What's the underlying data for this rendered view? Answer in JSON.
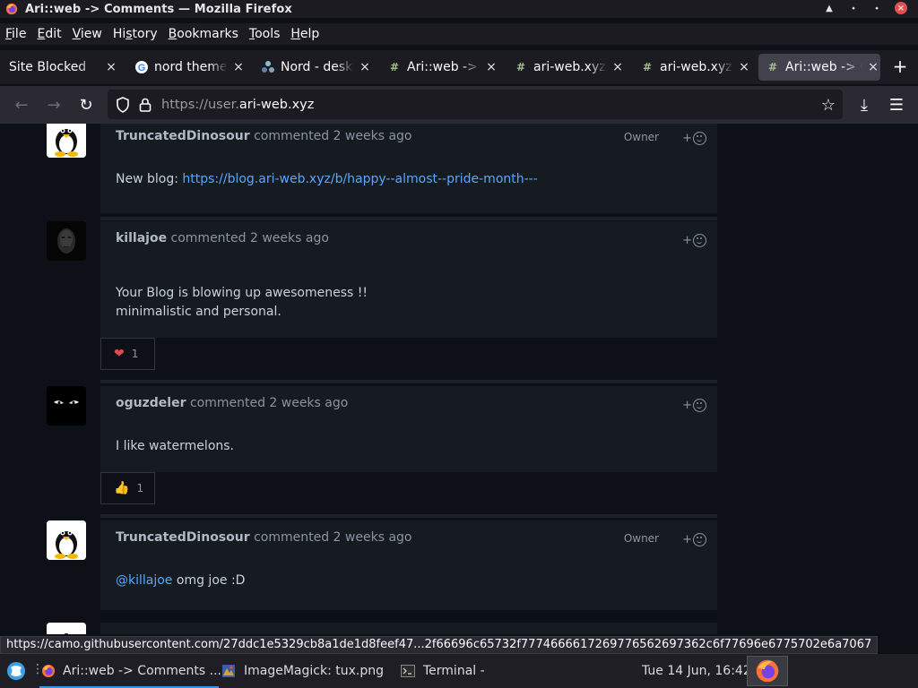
{
  "window": {
    "title": "Ari::web -> Comments — Mozilla Firefox",
    "controls": {
      "maximize": "▲",
      "minimize": "⬩",
      "restore": "⬩",
      "close": "×"
    }
  },
  "menu": {
    "items": [
      {
        "label": "File",
        "key": "F",
        "rest": "ile"
      },
      {
        "label": "Edit",
        "key": "E",
        "rest": "dit"
      },
      {
        "label": "View",
        "key": "V",
        "rest": "iew"
      },
      {
        "label": "History",
        "pre": "Hi",
        "key": "s",
        "rest": "tory"
      },
      {
        "label": "Bookmarks",
        "key": "B",
        "rest": "ookmarks"
      },
      {
        "label": "Tools",
        "key": "T",
        "rest": "ools"
      },
      {
        "label": "Help",
        "key": "H",
        "rest": "elp"
      }
    ]
  },
  "tabs": [
    {
      "label": "Site Blocked",
      "icon": "none",
      "active": false
    },
    {
      "label": "nord theme",
      "icon": "google-icon",
      "active": false
    },
    {
      "label": "Nord - deskt",
      "icon": "nord-icon",
      "active": false
    },
    {
      "label": "Ari::web -> C",
      "icon": "hash-icon",
      "active": false
    },
    {
      "label": "ari-web.xyz/",
      "icon": "hash-icon",
      "active": false
    },
    {
      "label": "ari-web.xyz/",
      "icon": "hash-icon",
      "active": false
    },
    {
      "label": "Ari::web -> C",
      "icon": "hash-icon",
      "active": true
    }
  ],
  "newtab_label": "+",
  "nav": {
    "url_prefix": "https://user.",
    "url_host": "ari-web.xyz",
    "icons": {
      "back": "←",
      "forward": "→",
      "reload": "↻",
      "bookmark": "☆",
      "downloads": "⤓",
      "menu": "☰"
    }
  },
  "comments": [
    {
      "author": "TruncatedDinosour",
      "meta": "commented 2 weeks ago",
      "owner": "Owner",
      "body_prefix": "New blog: ",
      "link": "https://blog.ari-web.xyz/b/happy--almost--pride-month---",
      "avatar": "tux"
    },
    {
      "author": "killajoe",
      "meta": "commented 2 weeks ago",
      "body_lines": [
        "Your Blog is blowing up awesomeness !!",
        "minimalistic and personal."
      ],
      "reaction": {
        "emoji": "❤️",
        "count": "1"
      },
      "avatar": "dark-face"
    },
    {
      "author": "oguzdeler",
      "meta": "commented 2 weeks ago",
      "body": "I like watermelons.",
      "reaction": {
        "emoji": "👍",
        "count": "1"
      },
      "avatar": "eyes"
    },
    {
      "author": "TruncatedDinosour",
      "meta": "commented 2 weeks ago",
      "owner": "Owner",
      "mention": "@killajoe",
      "body_after": " omg joe :D",
      "avatar": "tux"
    }
  ],
  "emoji_add_label": "+",
  "status_url": "https://camo.githubusercontent.com/27ddc1e5329cb8a1de1d8feef47...2f66696c65732f7774666617269776562697362c6f77696e6775702e6a7067",
  "taskbar": {
    "tasks": [
      {
        "label": "Ari::web -> Comments ...",
        "icon": "firefox-icon",
        "active": true
      },
      {
        "label": "ImageMagick: tux.png",
        "icon": "imagemagick-icon",
        "active": false
      },
      {
        "label": "Terminal -",
        "icon": "terminal-icon",
        "active": false
      }
    ],
    "separator": "⋮",
    "clock": "Tue 14 Jun, 16:42"
  },
  "colors": {
    "page_bg": "#0d1117",
    "comment_bg": "#161b22",
    "link": "#58a6ff",
    "text": "#c9d1d9",
    "muted": "#8b949e",
    "chrome": "#1c1b22",
    "toolbar": "#2b2a33"
  }
}
